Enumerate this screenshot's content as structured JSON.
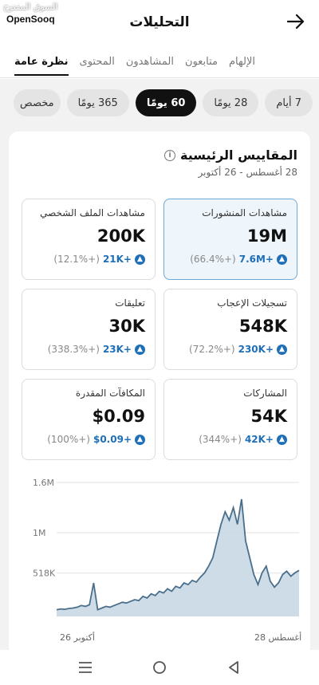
{
  "watermark": {
    "arabic": "السوق المفتوح",
    "brand": "OpenSooq"
  },
  "header": {
    "title": "التحليلات",
    "back_icon": "arrow-right-icon"
  },
  "tabs": [
    {
      "label": "نظرة عامة",
      "active": true
    },
    {
      "label": "المحتوى",
      "active": false
    },
    {
      "label": "المشاهدون",
      "active": false
    },
    {
      "label": "متابعون",
      "active": false
    },
    {
      "label": "الإلهام",
      "active": false
    }
  ],
  "periods": [
    {
      "label": "7 أيام",
      "active": false
    },
    {
      "label": "28 يومًا",
      "active": false
    },
    {
      "label": "60 يومًا",
      "active": true
    },
    {
      "label": "365 يومًا",
      "active": false
    },
    {
      "label": "مخصص",
      "active": false
    }
  ],
  "section": {
    "title": "المقاييس الرئيسية",
    "date_range": "28 أغسطس - 26 أكتوبر"
  },
  "metrics": [
    {
      "label": "مشاهدات المنشورات",
      "value": "19M",
      "delta": "7.6M+",
      "pct": "(66.4%+)",
      "selected": true
    },
    {
      "label": "مشاهدات الملف الشخصي",
      "value": "200K",
      "delta": "21K+",
      "pct": "(12.1%+)",
      "selected": false
    },
    {
      "label": "تسجيلات الإعجاب",
      "value": "548K",
      "delta": "230K+",
      "pct": "(72.2%+)",
      "selected": false
    },
    {
      "label": "تعليقات",
      "value": "30K",
      "delta": "23K+",
      "pct": "(338.3%+)",
      "selected": false
    },
    {
      "label": "المشاركات",
      "value": "54K",
      "delta": "42K+",
      "pct": "(344%+)",
      "selected": false
    },
    {
      "label": "المكافآت المقدرة",
      "value": "$0.09",
      "delta": "$0.09+",
      "pct": "(100%+)",
      "selected": false
    }
  ],
  "chart_data": {
    "type": "area",
    "y_tick_labels": [
      "518K",
      "1M",
      "1.6M"
    ],
    "y_ticks": [
      518000,
      1000000,
      1600000
    ],
    "ylim": [
      0,
      1600000
    ],
    "x_labels": [
      "26 أكتوبر",
      "28 أغسطس"
    ],
    "color": "#4a6f8c",
    "fill": "#c9d8e4",
    "series": [
      {
        "values": [
          80000,
          90000,
          85000,
          95000,
          100000,
          110000,
          130000,
          120000,
          140000,
          400000,
          80000,
          100000,
          120000,
          110000,
          130000,
          150000,
          170000,
          160000,
          180000,
          200000,
          190000,
          240000,
          220000,
          270000,
          250000,
          300000,
          280000,
          330000,
          300000,
          360000,
          340000,
          400000,
          380000,
          430000,
          410000,
          470000,
          520000,
          600000,
          700000,
          900000,
          1100000,
          1250000,
          1150000,
          1300000,
          1100000,
          1400000,
          900000,
          700000,
          500000,
          380000,
          520000,
          600000,
          420000,
          350000,
          400000,
          500000,
          540000,
          480000,
          520000,
          550000
        ]
      }
    ]
  },
  "navbar": [
    "menu-icon",
    "home-circle-icon",
    "back-triangle-icon"
  ]
}
